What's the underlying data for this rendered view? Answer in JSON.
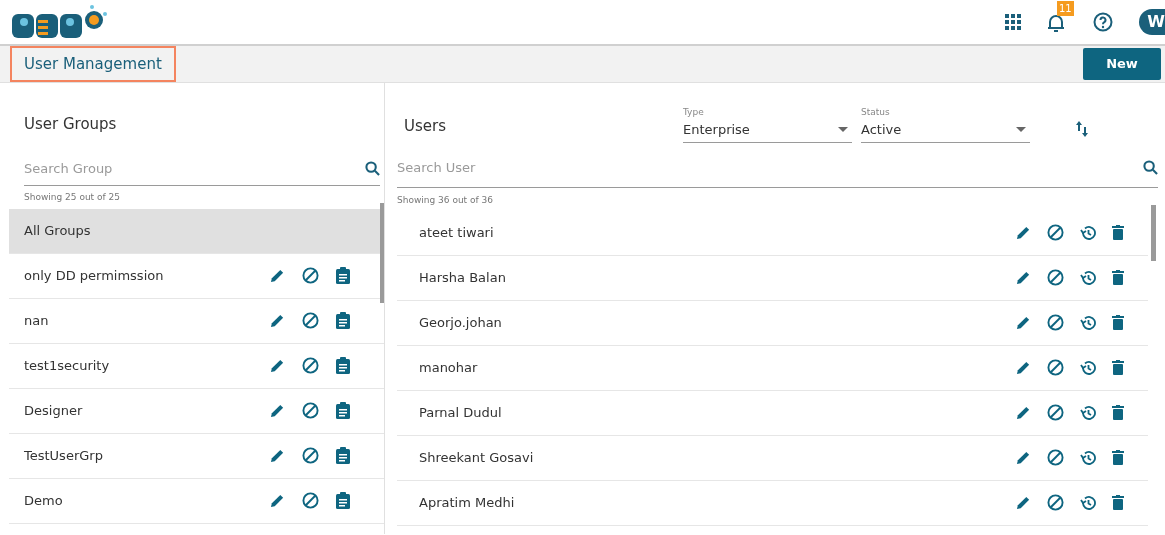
{
  "header": {
    "notifications": "11",
    "avatar": "W"
  },
  "title_bar": {
    "title": "User Management",
    "new_button": "New"
  },
  "groups_panel": {
    "heading": "User Groups",
    "search": {
      "placeholder": "Search Group"
    },
    "count": "Showing 25 out of 25",
    "items": [
      {
        "label": "All Groups",
        "selected": true,
        "kind": "plain"
      },
      {
        "label": "only DD permimssion",
        "selected": false,
        "kind": "actions"
      },
      {
        "label": "nan",
        "selected": false,
        "kind": "actions"
      },
      {
        "label": "test1security",
        "selected": false,
        "kind": "actions"
      },
      {
        "label": "Designer",
        "selected": false,
        "kind": "actions"
      },
      {
        "label": "TestUserGrp",
        "selected": false,
        "kind": "actions"
      },
      {
        "label": "Demo",
        "selected": false,
        "kind": "actions"
      }
    ]
  },
  "users_panel": {
    "heading": "Users",
    "type_filter": {
      "label": "Type",
      "value": "Enterprise"
    },
    "status_filter": {
      "label": "Status",
      "value": "Active"
    },
    "search": {
      "placeholder": "Search User"
    },
    "count": "Showing 36 out of 36",
    "users": [
      "ateet tiwari",
      "Harsha Balan",
      "Georjo.johan",
      "manohar",
      "Parnal Dudul",
      "Shreekant Gosavi",
      "Apratim Medhi"
    ]
  }
}
